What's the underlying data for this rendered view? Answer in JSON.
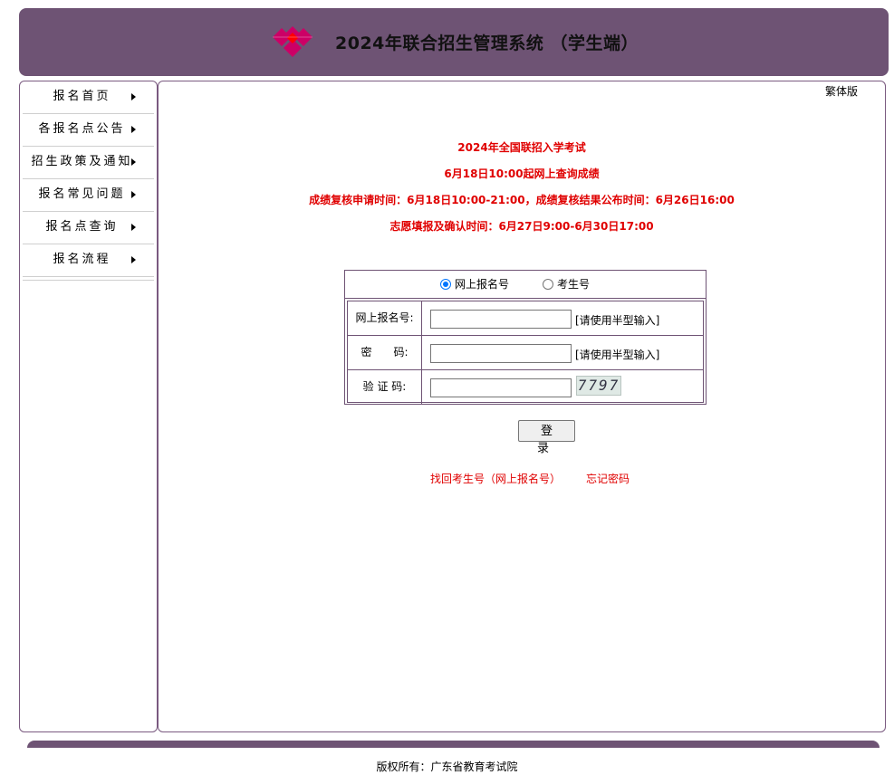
{
  "header": {
    "title": "2024年联合招生管理系统  （学生端）",
    "accent_color": "#6e5374",
    "logo_colors": [
      "#cc0066",
      "#ff0000"
    ]
  },
  "sidebar": {
    "items": [
      {
        "label": "报名首页"
      },
      {
        "label": "各报名点公告"
      },
      {
        "label": "招生政策及通知"
      },
      {
        "label": "报名常见问题"
      },
      {
        "label": "报名点查询"
      },
      {
        "label": "报名流程"
      }
    ]
  },
  "main": {
    "lang_toggle": "繁体版",
    "notices": [
      "2024年全国联招入学考试",
      "6月18日10:00起网上查询成绩",
      "成绩复核申请时间：6月18日10:00-21:00，成绩复核结果公布时间：6月26日16:00",
      "志愿填报及确认时间：6月27日9:00-6月30日17:00"
    ],
    "notice_color": "#e00000"
  },
  "login": {
    "radio_online": "网上报名号",
    "radio_exam": "考生号",
    "selected": "网上报名号",
    "field_regno_label": "网上报名号:",
    "field_regno_value": "",
    "field_regno_hint": "[请使用半型输入]",
    "field_password_label": "密　　码:",
    "field_password_value": "",
    "field_password_hint": "[请使用半型输入]",
    "field_captcha_label": "验 证 码:",
    "field_captcha_value": "",
    "captcha_text": "7797",
    "submit_label": "登 录",
    "link_recover": "找回考生号（网上报名号）",
    "link_forgot": "忘记密码"
  },
  "footer": {
    "copyright": "版权所有：广东省教育考试院"
  }
}
